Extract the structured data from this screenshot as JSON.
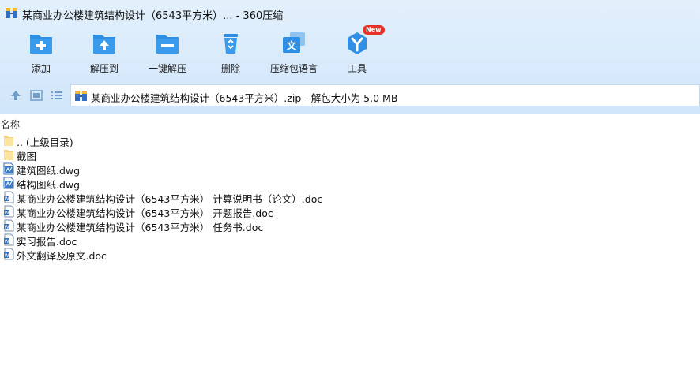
{
  "window": {
    "title": "某商业办公楼建筑结构设计（6543平方米）... - 360压缩"
  },
  "toolbar": {
    "items": [
      {
        "label": "添加",
        "icon": "add-icon"
      },
      {
        "label": "解压到",
        "icon": "extract-to-icon"
      },
      {
        "label": "一键解压",
        "icon": "one-click-extract-icon"
      },
      {
        "label": "删除",
        "icon": "delete-icon"
      },
      {
        "label": "压缩包语言",
        "icon": "archive-language-icon"
      },
      {
        "label": "工具",
        "icon": "tools-icon",
        "badge": "New"
      }
    ]
  },
  "address": {
    "text": "某商业办公楼建筑结构设计（6543平方米）.zip - 解包大小为 5.0 MB"
  },
  "columns": {
    "name": "名称"
  },
  "files": [
    {
      "name": ".. (上级目录)",
      "type": "folder"
    },
    {
      "name": "截图",
      "type": "folder"
    },
    {
      "name": "建筑图纸.dwg",
      "type": "dwg"
    },
    {
      "name": "结构图纸.dwg",
      "type": "dwg"
    },
    {
      "name": "某商业办公楼建筑结构设计（6543平方米） 计算说明书（论文）.doc",
      "type": "doc"
    },
    {
      "name": "某商业办公楼建筑结构设计（6543平方米） 开题报告.doc",
      "type": "doc"
    },
    {
      "name": "某商业办公楼建筑结构设计（6543平方米） 任务书.doc",
      "type": "doc"
    },
    {
      "name": "实习报告.doc",
      "type": "doc"
    },
    {
      "name": "外文翻译及原文.doc",
      "type": "doc"
    }
  ],
  "colors": {
    "accent": "#2f8fe4",
    "chrome_bg": "#d8eafb",
    "badge": "#e5332a"
  }
}
